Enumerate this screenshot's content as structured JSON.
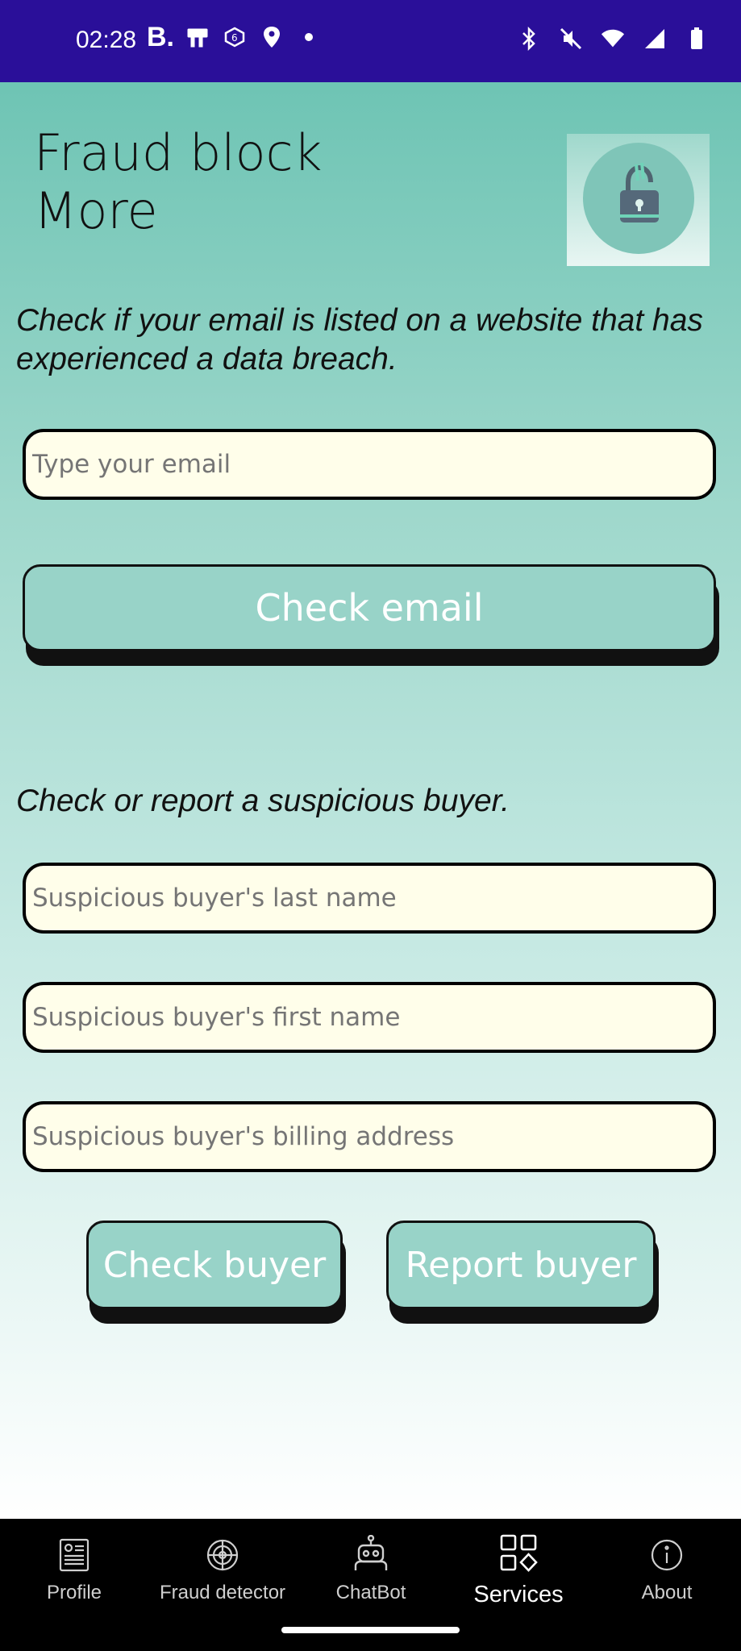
{
  "status": {
    "time": "02:28",
    "left_icons": [
      "booking-b-icon",
      "photo-icon",
      "app-icon",
      "location-icon",
      "dot-icon"
    ],
    "right_icons": [
      "bluetooth-icon",
      "mute-icon",
      "wifi-icon",
      "signal-icon",
      "battery-icon"
    ]
  },
  "header": {
    "title_line1": "Fraud block",
    "title_line2": "More",
    "logo_icon": "padlock-icon"
  },
  "email_section": {
    "description": "Check if your email is listed on a website that has experienced a data breach.",
    "input_placeholder": "Type your email",
    "button_label": "Check email"
  },
  "buyer_section": {
    "description": "Check or report a suspicious buyer.",
    "last_name_placeholder": "Suspicious buyer's last name",
    "first_name_placeholder": "Suspicious buyer's first name",
    "address_placeholder": "Suspicious buyer's billing address",
    "check_label": "Check buyer",
    "report_label": "Report buyer"
  },
  "nav": {
    "items": [
      {
        "label": "Profile",
        "icon": "profile-icon"
      },
      {
        "label": "Fraud detector",
        "icon": "radar-icon"
      },
      {
        "label": "ChatBot",
        "icon": "robot-icon"
      },
      {
        "label": "Services",
        "icon": "grid-icon"
      },
      {
        "label": "About",
        "icon": "info-icon"
      }
    ],
    "active": "Services"
  },
  "colors": {
    "status_bar": "#2a0f99",
    "accent_teal": "#98d3c8",
    "input_bg": "#fffeea"
  }
}
